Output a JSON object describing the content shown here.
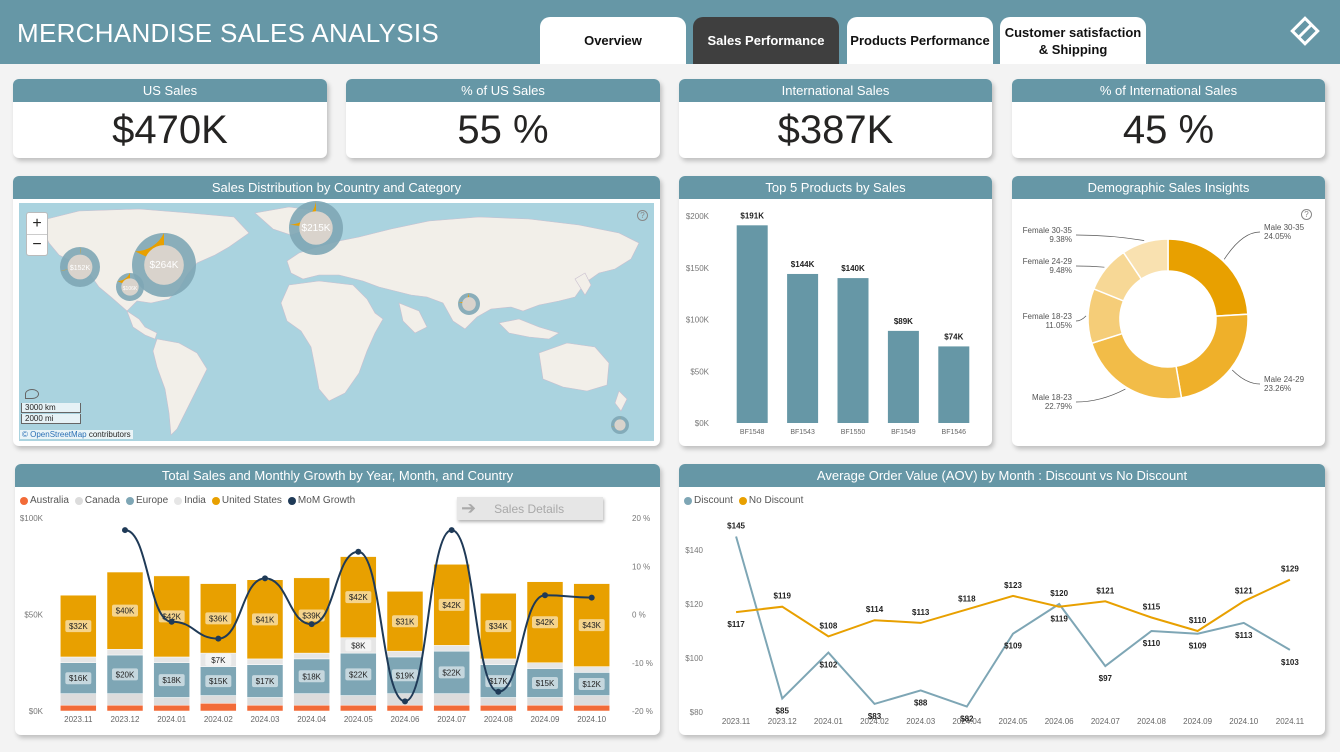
{
  "header": {
    "title": "MERCHANDISE SALES ANALYSIS",
    "tabs": [
      {
        "label": "Overview",
        "active": false
      },
      {
        "label": "Sales Performance",
        "active": true
      },
      {
        "label": "Products Performance",
        "active": false
      },
      {
        "label": "Customer satisfaction\n& Shipping",
        "active": false
      }
    ],
    "logo_icon": "diamond-logo-icon"
  },
  "kpis": [
    {
      "label": "US Sales",
      "value": "$470K"
    },
    {
      "label": "% of US Sales",
      "value": "55 %"
    },
    {
      "label": "International Sales",
      "value": "$387K"
    },
    {
      "label": "% of International Sales",
      "value": "45 %"
    }
  ],
  "map": {
    "title": "Sales Distribution by Country and Category",
    "zoom_in": "+",
    "zoom_out": "−",
    "scale_km": "3000 km",
    "scale_mi": "2000 mi",
    "attribution_link": "© OpenStreetMap",
    "attribution_rest": " contributors",
    "bubbles": [
      {
        "label": "$264K",
        "value": 264
      },
      {
        "label": "$215K",
        "value": 215
      },
      {
        "label": "$152K",
        "value": 152
      },
      {
        "label": "$106K",
        "value": 106
      },
      {
        "label": "",
        "value": 60
      },
      {
        "label": "",
        "value": 40
      }
    ]
  },
  "chart_data": [
    {
      "type": "bar",
      "title": "Top 5 Products by Sales",
      "categories": [
        "BF1548",
        "BF1543",
        "BF1550",
        "BF1549",
        "BF1546"
      ],
      "values": [
        191,
        144,
        140,
        89,
        74
      ],
      "data_labels": [
        "$191K",
        "$144K",
        "$140K",
        "$89K",
        "$74K"
      ],
      "yticks": [
        "$0K",
        "$50K",
        "$100K",
        "$150K",
        "$200K"
      ],
      "ylim": [
        0,
        200
      ],
      "color": "#6697a6"
    },
    {
      "type": "pie",
      "title": "Demographic Sales Insights",
      "slices": [
        {
          "label": "Male 30-35",
          "value": 24.05,
          "text": "24.05%",
          "color": "#e8a000"
        },
        {
          "label": "Male 24-29",
          "value": 23.26,
          "text": "23.26%",
          "color": "#efb02a"
        },
        {
          "label": "Male 18-23",
          "value": 22.79,
          "text": "22.79%",
          "color": "#f2bc48"
        },
        {
          "label": "Female 18-23",
          "value": 11.05,
          "text": "11.05%",
          "color": "#f5cd78"
        },
        {
          "label": "Female 24-29",
          "value": 9.48,
          "text": "9.48%",
          "color": "#f7d896"
        },
        {
          "label": "Female 30-35",
          "value": 9.38,
          "text": "9.38%",
          "color": "#f9e1b0"
        }
      ]
    },
    {
      "type": "bar",
      "title": "Total Sales and Monthly Growth by Year, Month, and Country",
      "categories": [
        "2023.11",
        "2023.12",
        "2024.01",
        "2024.02",
        "2024.03",
        "2024.04",
        "2024.05",
        "2024.06",
        "2024.07",
        "2024.08",
        "2024.09",
        "2024.10"
      ],
      "series": [
        {
          "name": "Australia",
          "color": "#f26b38",
          "values": [
            3,
            3,
            3,
            4,
            3,
            3,
            3,
            3,
            3,
            3,
            3,
            3
          ]
        },
        {
          "name": "Canada",
          "color": "#dcdcdc",
          "values": [
            6,
            6,
            4,
            4,
            4,
            6,
            5,
            6,
            6,
            4,
            4,
            5
          ]
        },
        {
          "name": "Europe",
          "color": "#7ea6b5",
          "values": [
            16,
            20,
            18,
            15,
            17,
            18,
            22,
            19,
            22,
            17,
            15,
            12
          ],
          "labels": [
            "$16K",
            "$20K",
            "$18K",
            "$15K",
            "$17K",
            "$18K",
            "$22K",
            "$19K",
            "$22K",
            "$17K",
            "$15K",
            "$12K"
          ]
        },
        {
          "name": "India",
          "color": "#e6e6e6",
          "values": [
            3,
            3,
            3,
            7,
            3,
            3,
            8,
            3,
            3,
            3,
            3,
            3
          ],
          "labels": [
            "",
            "",
            "",
            "$7K",
            "",
            "",
            "$8K",
            "",
            "",
            "",
            "",
            ""
          ]
        },
        {
          "name": "United States",
          "color": "#e8a000",
          "values": [
            32,
            40,
            42,
            36,
            41,
            39,
            42,
            31,
            42,
            34,
            42,
            43
          ],
          "labels": [
            "$32K",
            "$40K",
            "$42K",
            "$36K",
            "$41K",
            "$39K",
            "$42K",
            "$31K",
            "$42K",
            "$34K",
            "$42K",
            "$43K"
          ]
        }
      ],
      "line": {
        "name": "MoM Growth",
        "color": "#1f3a57",
        "values": [
          null,
          17.5,
          -1.5,
          -5,
          7.5,
          -2,
          13,
          -18,
          17.5,
          -16,
          4,
          3.5
        ]
      },
      "yticks": [
        "$0K",
        "$50K",
        "$100K"
      ],
      "ylim": [
        0,
        100
      ],
      "y2ticks": [
        "-20 %",
        "-10 %",
        "0 %",
        "10 %",
        "20 %"
      ],
      "y2lim": [
        -20,
        20
      ],
      "button_label": "Sales Details"
    },
    {
      "type": "line",
      "title": "Average Order Value (AOV) by Month : Discount vs No Discount",
      "categories": [
        "2023.11",
        "2023.12",
        "2024.01",
        "2024.02",
        "2024.03",
        "2024.04",
        "2024.05",
        "2024.06",
        "2024.07",
        "2024.08",
        "2024.09",
        "2024.10",
        "2024.11"
      ],
      "series": [
        {
          "name": "Discount",
          "color": "#7ea6b5",
          "values": [
            145,
            85,
            102,
            83,
            88,
            82,
            109,
            120,
            97,
            110,
            109,
            113,
            103
          ]
        },
        {
          "name": "No Discount",
          "color": "#e8a000",
          "values": [
            117,
            119,
            108,
            114,
            113,
            118,
            123,
            119,
            121,
            115,
            110,
            121,
            129
          ]
        }
      ],
      "yticks": [
        "$80",
        "$100",
        "$120",
        "$140"
      ],
      "ylim": [
        80,
        150
      ]
    }
  ],
  "colors": {
    "header": "#6697a6",
    "accent": "#e8a000",
    "dark_tab": "#3f3f3f"
  }
}
